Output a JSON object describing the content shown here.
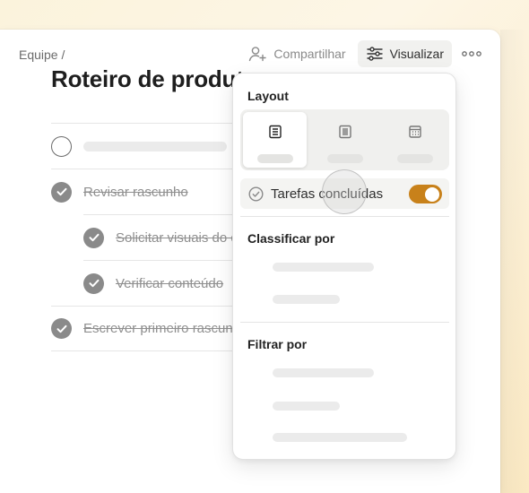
{
  "breadcrumb": "Equipe /",
  "toolbar": {
    "share_label": "Compartilhar",
    "view_label": "Visualizar",
    "more_icon": "more-horizontal-icon"
  },
  "page_title": "Roteiro de produto",
  "tasks": [
    {
      "label": "",
      "done": false
    },
    {
      "label": "Revisar rascunho",
      "done": true
    },
    {
      "label": "Solicitar visuais do design",
      "done": true
    },
    {
      "label": "Verificar conteúdo",
      "done": true
    },
    {
      "label": "Escrever primeiro rascunho",
      "done": true
    }
  ],
  "view_menu": {
    "layout_heading": "Layout",
    "layout_options": [
      "list-icon",
      "board-icon",
      "calendar-icon"
    ],
    "selected_layout": 0,
    "completed_tasks_label": "Tarefas concluídas",
    "completed_tasks_on": true,
    "sort_heading": "Classificar por",
    "filter_heading": "Filtrar por"
  },
  "colors": {
    "accent": "#c8811a",
    "text_muted": "#8f8f8f"
  }
}
